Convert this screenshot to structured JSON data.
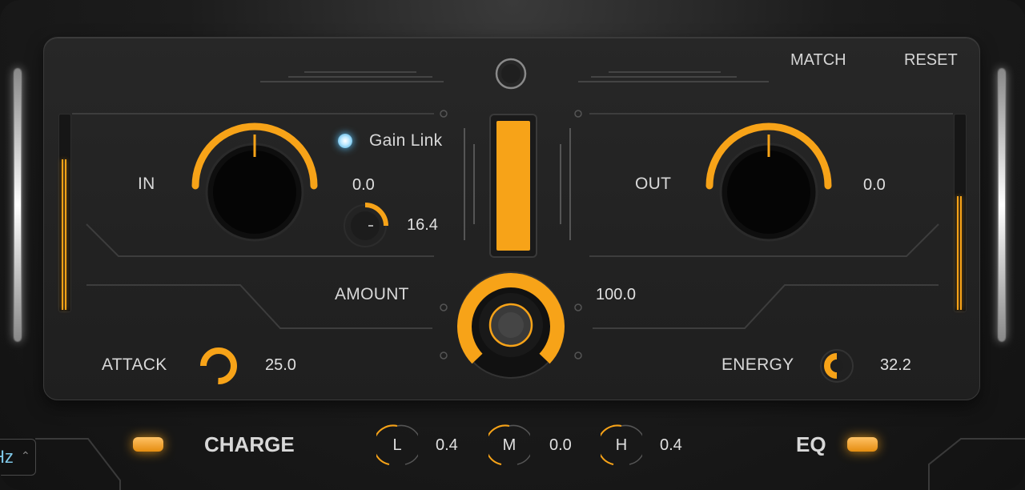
{
  "colors": {
    "accent": "#f7a318",
    "background": "#1f1f1f",
    "text": "#d9d9d9",
    "led": "#5cc6ff"
  },
  "header": {
    "match_label": "MATCH",
    "reset_label": "RESET",
    "logo_icon": "circle-logo-icon"
  },
  "input": {
    "label": "IN",
    "value": "0.0"
  },
  "output": {
    "label": "OUT",
    "value": "0.0"
  },
  "gain_link": {
    "label": "Gain Link",
    "enabled": true
  },
  "mini_knob": {
    "value": "16.4"
  },
  "amount": {
    "label": "AMOUNT",
    "value": "100.0"
  },
  "attack": {
    "label": "ATTACK",
    "value": "25.0"
  },
  "energy": {
    "label": "ENERGY",
    "value": "32.2"
  },
  "meter": {
    "level": 1.0
  },
  "bottom_bar": {
    "charge_label": "CHARGE",
    "eq_label": "EQ",
    "bands": [
      {
        "label": "L",
        "value": "0.4"
      },
      {
        "label": "M",
        "value": "0.0"
      },
      {
        "label": "H",
        "value": "0.4"
      }
    ]
  },
  "corner_field": {
    "text": "Hz"
  }
}
